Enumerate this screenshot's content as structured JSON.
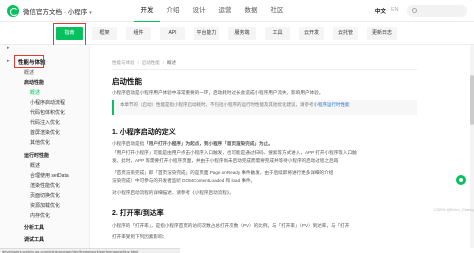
{
  "header": {
    "brand": "微信官方文档",
    "product": "小程序",
    "nav": [
      "开发",
      "介绍",
      "设计",
      "运营",
      "数据",
      "社区"
    ],
    "active_nav": "开发",
    "lang_zh": "中文",
    "lang_en": "EN"
  },
  "subnav": {
    "items": [
      "指南",
      "框架",
      "组件",
      "API",
      "平台能力",
      "服务端",
      "工具",
      "云开发",
      "云托管",
      "更新日志"
    ],
    "active": "指南"
  },
  "sidebar": {
    "items": [
      {
        "label": "性能与体验",
        "kind": "cat"
      },
      {
        "label": "概述",
        "kind": "sub"
      },
      {
        "label": "启动性能",
        "kind": "sub"
      },
      {
        "label": "概述",
        "kind": "leaf",
        "active": true
      },
      {
        "label": "小程序启动流程",
        "kind": "leaf"
      },
      {
        "label": "代码包体积优化",
        "kind": "leaf"
      },
      {
        "label": "代码注入优化",
        "kind": "leaf"
      },
      {
        "label": "首屏渲染优化",
        "kind": "leaf"
      },
      {
        "label": "其他优化",
        "kind": "leaf"
      },
      {
        "label": "运行时性能",
        "kind": "sub"
      },
      {
        "label": "概述",
        "kind": "leaf"
      },
      {
        "label": "合理使用 setData",
        "kind": "leaf"
      },
      {
        "label": "渲染性能优化",
        "kind": "leaf"
      },
      {
        "label": "页面切换优化",
        "kind": "leaf"
      },
      {
        "label": "资源加载优化",
        "kind": "leaf"
      },
      {
        "label": "内存优化",
        "kind": "leaf"
      },
      {
        "label": "分析工具",
        "kind": "sub"
      },
      {
        "label": "调试工具",
        "kind": "sub"
      }
    ]
  },
  "breadcrumb": [
    "性能与体验",
    "启动性能",
    "概述"
  ],
  "content": {
    "title": "启动性能",
    "intro": "小程序启动是小程序用户体验中非常重要的一环，启动耗时过长会造成小程序用户流失，影响用户体验。",
    "note_prefix": "本章节的（启动）性能是指小程序启动耗时，不包括小程序的运行时性能及其他优化建议，请参考",
    "note_link": "小程序运行时性能",
    "h2_1": "1. 小程序启动的定义",
    "def_1": "小程序启动是指",
    "def_1_bold": "「用户打开小程序」为起点，到小程序「首页渲染完成」为止。",
    "def_2": "「用户打开小程序」可能是由用户点击小程序入口触发，也可能是通过扫码、搜索等方式进入，APP 打开小程序等入口触",
    "def_3": "发。此时，APP 等需要打开小程序页面，并由于小程序尚未启动完成而需要完成并等待小程序的启动过程之后再",
    "def_4": "「首页渲染完成」即「首页渲染完成」的是页面 Page.onReady 事件触发，由于后续即将进行更多详细的介绍",
    "def_5": "渲染完成）中可参与的开发者监听 DOMContentLoaded 和 load 事件。",
    "def_6": "对小程序启动流程的详细描述，请参考《小程序启动流程》。",
    "h2_2": "2. 打开率/到达率",
    "rate_1": "小程序的「打开率」，是指小程序首页的访问次数占总打开次数（PV）的比例，与「打开率」（PV）到达率，与「打开",
    "rate_2": "打开率受到下列因素影响："
  },
  "watermark": "CSDN @Echo_Cheng",
  "status_url": "developers.weixin.qq.com/miniprogram/dev/framework/performance/tips.html",
  "colors": {
    "accent": "#07c160",
    "highlight": "#e53935",
    "link": "#1f6fd1"
  }
}
